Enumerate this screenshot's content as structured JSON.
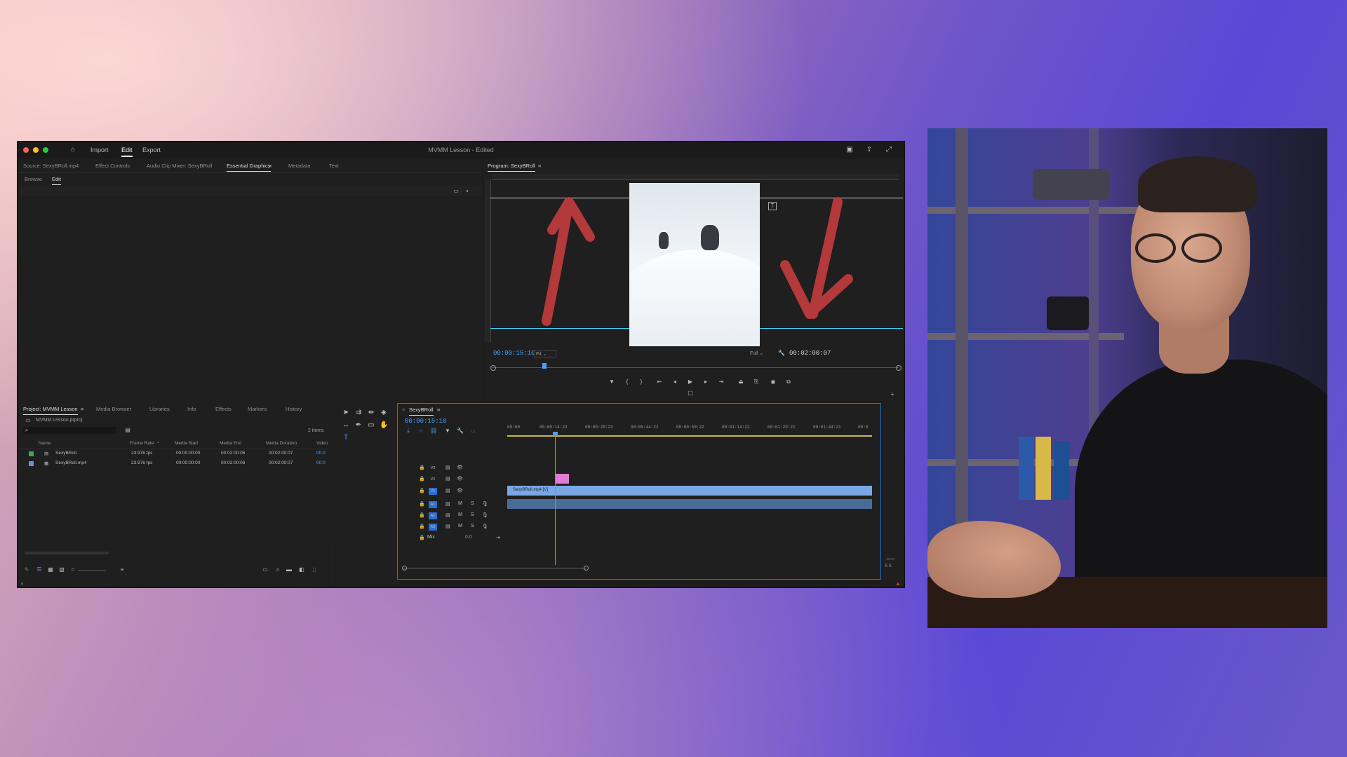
{
  "app": {
    "title": "MVMM Lesson",
    "title_suffix": " - Edited",
    "nav": {
      "import": "Import",
      "edit": "Edit",
      "export": "Export"
    }
  },
  "source_tabs": {
    "source": "Source: SexyBRoll.mp4",
    "effect_controls": "Effect Controls",
    "audio_mixer": "Audio Clip Mixer: SexyBRoll",
    "essential_graphics": "Essential Graphics",
    "metadata": "Metadata",
    "text": "Text"
  },
  "eg_subtabs": {
    "browse": "Browse",
    "edit": "Edit"
  },
  "program": {
    "tab": "Program: SexyBRoll",
    "timecode": "00:00:15:10",
    "fit": "Fit",
    "quality": "Full",
    "duration": "00:02:00:07"
  },
  "project": {
    "tabs": {
      "project": "Project: MVMM Lesson",
      "media_browser": "Media Browser",
      "libraries": "Libraries",
      "info": "Info",
      "effects": "Effects",
      "markers": "Markers",
      "history": "History"
    },
    "path": "MVMM Lesson.prproj",
    "item_count": "2 items",
    "columns": {
      "name": "Name",
      "frame_rate": "Frame Rate",
      "media_start": "Media Start",
      "media_end": "Media End",
      "media_duration": "Media Duration",
      "video": "Video"
    },
    "rows": [
      {
        "name": "SexyBRoll",
        "frame_rate": "23.976 fps",
        "media_start": "00:00:00:00",
        "media_end": "00:02:00:06",
        "media_duration": "00:02:00:07",
        "video": "00:0",
        "color": "#3fa84a"
      },
      {
        "name": "SexyBRoll.mp4",
        "frame_rate": "23.976 fps",
        "media_start": "00:00:00:00",
        "media_end": "00:02:00:06",
        "media_duration": "00:02:00:07",
        "video": "00:0",
        "color": "#6c8ed6"
      }
    ]
  },
  "timeline": {
    "tab": "SexyBRoll",
    "timecode": "00:00:15:10",
    "ruler": [
      "00:00",
      "00:00:14:23",
      "00:00:29:23",
      "00:00:44:22",
      "00:00:59:22",
      "00:01:14:22",
      "00:01:29:21",
      "00:01:44:21",
      "00:0"
    ],
    "tracks": {
      "v3": "V3",
      "v2": "V2",
      "v1": "V1",
      "a1": "A1",
      "a2": "A2",
      "a3": "A3",
      "mix": "Mix",
      "mix_value": "0.0",
      "m": "M",
      "s": "S"
    },
    "clip_label": "SexyBRoll.mp4 [V]",
    "meter_label": "S S"
  },
  "colors": {
    "accent_blue": "#2d6fd1",
    "timecode_blue": "#4aa0ff",
    "clip_blue": "#7aa7e6",
    "clip_pink": "#e27bd4",
    "arrow_red": "#b3393a",
    "guide_cyan": "#3fd9ff"
  }
}
